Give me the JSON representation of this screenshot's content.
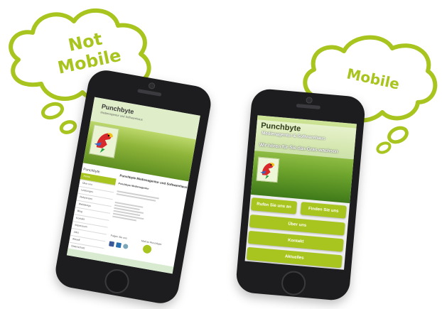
{
  "bubbles": {
    "left_line1": "Not",
    "left_line2": "Mobile",
    "right": "Mobile"
  },
  "left_site": {
    "title": "Punchbyte",
    "subtitle": "Medienagentur und Softwarehaus",
    "nav_title": "Punchbyte",
    "nav_items": [
      "Home",
      "Über uns",
      "Leistungen",
      "Referenzen",
      "Webdesign",
      "Blog",
      "Kontakt",
      "Impressum",
      "Jobs",
      "Aktuell",
      "Datenschutz"
    ],
    "main_title": "Punchbyte Medienagentur und Softwarehaus",
    "main_subtitle": "Punchbyte Medienagentur",
    "follow_text": "Folgen Sie uns",
    "mail_text": "Mail an Punchbyte"
  },
  "right_site": {
    "title": "Punchbyte",
    "subtitle": "Medienagentur & Softwarehaus",
    "tagline": "Wir hören für Sie das Gras wachsen",
    "call_button": "Rufen Sie uns an",
    "find_button": "Finden Sie uns",
    "menu_buttons": [
      "Über uns",
      "Kontakt",
      "Aktuelles"
    ]
  },
  "colors": {
    "accent": "#a8c41e",
    "phone_body": "#1d1d1f"
  }
}
